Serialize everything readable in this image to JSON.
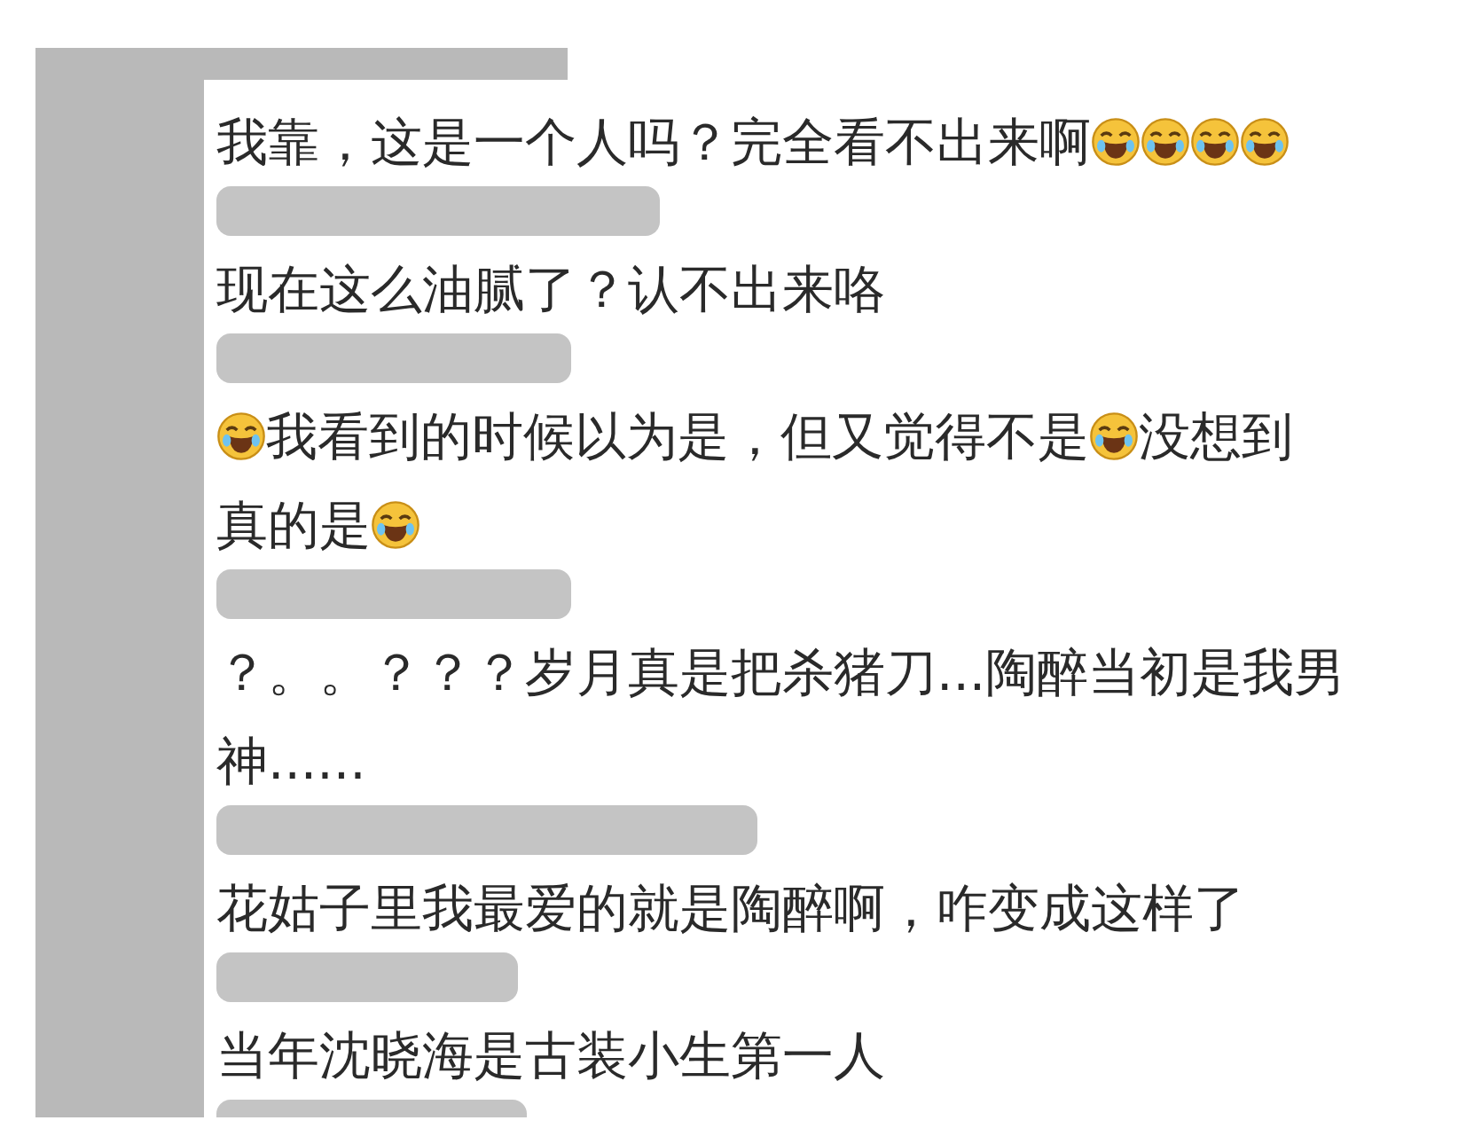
{
  "comments": [
    {
      "parts": [
        {
          "kind": "text",
          "text": "我靠，这是一个人吗？完全看不出来啊"
        },
        {
          "kind": "emoji"
        },
        {
          "kind": "emoji"
        },
        {
          "kind": "emoji"
        },
        {
          "kind": "emoji"
        }
      ]
    },
    {
      "parts": [
        {
          "kind": "text",
          "text": "现在这么油腻了？认不出来咯"
        }
      ]
    },
    {
      "parts": [
        {
          "kind": "emoji"
        },
        {
          "kind": "text",
          "text": "我看到的时候以为是，但又觉得不是"
        },
        {
          "kind": "emoji"
        },
        {
          "kind": "text",
          "text": "没想到"
        },
        {
          "kind": "text",
          "text": "真的是"
        },
        {
          "kind": "emoji"
        }
      ]
    },
    {
      "parts": [
        {
          "kind": "text",
          "text": "？。。？？？岁月真是把杀猪刀...陶醉当初是我男"
        },
        {
          "kind": "text",
          "text": "神......"
        }
      ]
    },
    {
      "parts": [
        {
          "kind": "text",
          "text": "花姑子里我最爱的就是陶醉啊，咋变成这样了"
        }
      ]
    },
    {
      "parts": [
        {
          "kind": "text",
          "text": "当年沈晓海是古装小生第一人"
        }
      ]
    }
  ]
}
